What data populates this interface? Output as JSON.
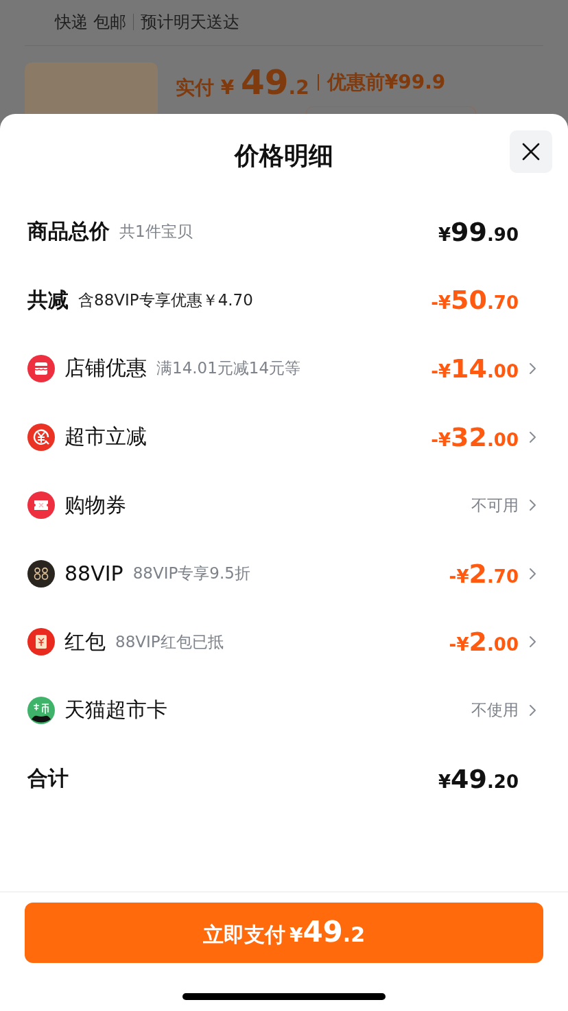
{
  "background": {
    "shipping": "快递 包邮",
    "delivery": "预计明天送达",
    "paid_label": "实付",
    "paid_currency": "¥",
    "paid_integer": "49",
    "paid_decimal": ".2",
    "original_label": "优惠前",
    "original_price": "¥99.9"
  },
  "sheet": {
    "title": "价格明细",
    "rows": [
      {
        "kind": "summary",
        "label": "商品总价",
        "note": "共1件宝贝",
        "discount": false,
        "chevron": false,
        "amount": {
          "sign": "¥",
          "integer": "99",
          "decimal": ".90"
        }
      },
      {
        "kind": "summary",
        "label": "共减",
        "note": "含88VIP专享优惠￥4.70",
        "discount": true,
        "chevron": false,
        "amount": {
          "sign": "-¥",
          "integer": "50",
          "decimal": ".70"
        }
      },
      {
        "kind": "shop",
        "label": "店铺优惠",
        "note": "满14.01元减14元等",
        "discount": true,
        "chevron": true,
        "amount": {
          "sign": "-¥",
          "integer": "14",
          "decimal": ".00"
        }
      },
      {
        "kind": "instant",
        "label": "超市立减",
        "discount": true,
        "chevron": true,
        "amount": {
          "sign": "-¥",
          "integer": "32",
          "decimal": ".00"
        }
      },
      {
        "kind": "coupon",
        "label": "购物券",
        "chevron": true,
        "status": "不可用"
      },
      {
        "kind": "vip",
        "label": "88VIP",
        "note": "88VIP专享9.5折",
        "discount": true,
        "chevron": true,
        "amount": {
          "sign": "-¥",
          "integer": "2",
          "decimal": ".70"
        }
      },
      {
        "kind": "envelope",
        "label": "红包",
        "note": "88VIP红包已抵",
        "discount": true,
        "chevron": true,
        "amount": {
          "sign": "-¥",
          "integer": "2",
          "decimal": ".00"
        }
      },
      {
        "kind": "card",
        "label": "天猫超市卡",
        "chevron": true,
        "status": "不使用"
      },
      {
        "kind": "summary",
        "label": "合计",
        "discount": false,
        "chevron": false,
        "amount": {
          "sign": "¥",
          "integer": "49",
          "decimal": ".20"
        }
      }
    ],
    "pay_button": {
      "label": "立即支付",
      "currency": "¥",
      "integer": "49",
      "decimal": ".2"
    }
  }
}
